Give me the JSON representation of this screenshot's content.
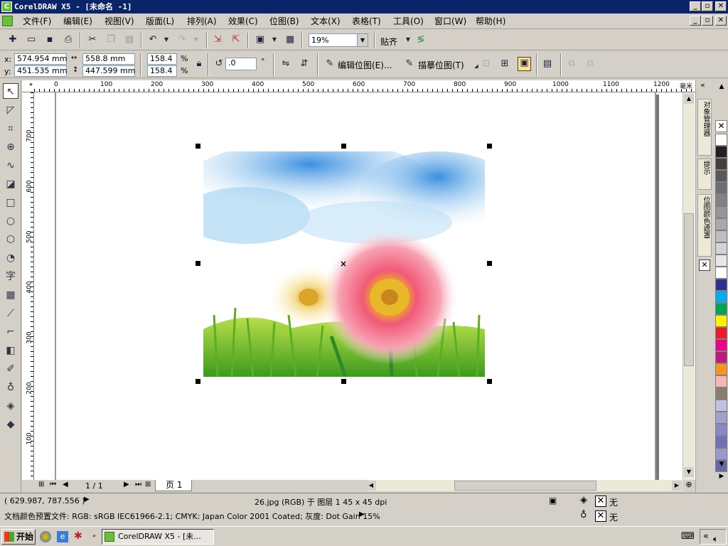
{
  "window": {
    "title": "CorelDRAW X5 - [未命名 -1]",
    "min": "_",
    "max": "▫",
    "close": "✕"
  },
  "menu": {
    "items": [
      "文件(F)",
      "编辑(E)",
      "视图(V)",
      "版面(L)",
      "排列(A)",
      "效果(C)",
      "位图(B)",
      "文本(X)",
      "表格(T)",
      "工具(O)",
      "窗口(W)",
      "帮助(H)"
    ]
  },
  "toolbar": {
    "zoom": "19%",
    "snap_label": "贴齐"
  },
  "props": {
    "x_label": "x:",
    "x_value": "574.954 mm",
    "y_label": "y:",
    "y_value": "451.535 mm",
    "w_value": "558.8 mm",
    "h_value": "447.599 mm",
    "sx": "158.4",
    "sy": "158.4",
    "pct": "%",
    "angle": ".0",
    "deg": "°",
    "edit_bitmap": "编辑位图(E)...",
    "trace_bitmap": "描摹位图(T)"
  },
  "ruler": {
    "unit": "毫米",
    "h_ticks": [
      "0",
      "100",
      "200",
      "300",
      "400",
      "500",
      "600",
      "700",
      "800",
      "900",
      "1000",
      "1100",
      "1200"
    ],
    "v_ticks": [
      "700",
      "600",
      "500",
      "400",
      "300",
      "200",
      "100"
    ]
  },
  "dockers": {
    "tab1": "对象管理器",
    "tab2": "提示",
    "tab3": "位图颜色遮罩"
  },
  "palette": [
    "#ffffff",
    "#231f20",
    "#404040",
    "#595959",
    "#6d6e70",
    "#808285",
    "#939598",
    "#a7a9ac",
    "#bcbec0",
    "#d1d3d4",
    "#e6e7e8",
    "#ffffff",
    "#2e3192",
    "#00aeef",
    "#00a651",
    "#fff200",
    "#ed1c24",
    "#ec008c",
    "#c2187d",
    "#f7941d",
    "#f5b7b1",
    "#8b7d6b",
    "#c0c0e0",
    "#a0a0d0",
    "#8888c8",
    "#7070b8",
    "#9999cc",
    "#6666aa"
  ],
  "pages": {
    "counter": "1 / 1",
    "tab": "页 1"
  },
  "status": {
    "coords": "( 629.987, 787.556 )",
    "object": "26.jpg (RGB) 于 图层 1 45 x 45 dpi",
    "profile": "文档颜色预置文件: RGB: sRGB IEC61966-2.1; CMYK: Japan Color 2001 Coated; 灰度: Dot Gain 15%",
    "fill_none": "无",
    "outline_none": "无"
  },
  "taskbar": {
    "start": "开始",
    "task": "CorelDRAW X5 - [未..."
  }
}
